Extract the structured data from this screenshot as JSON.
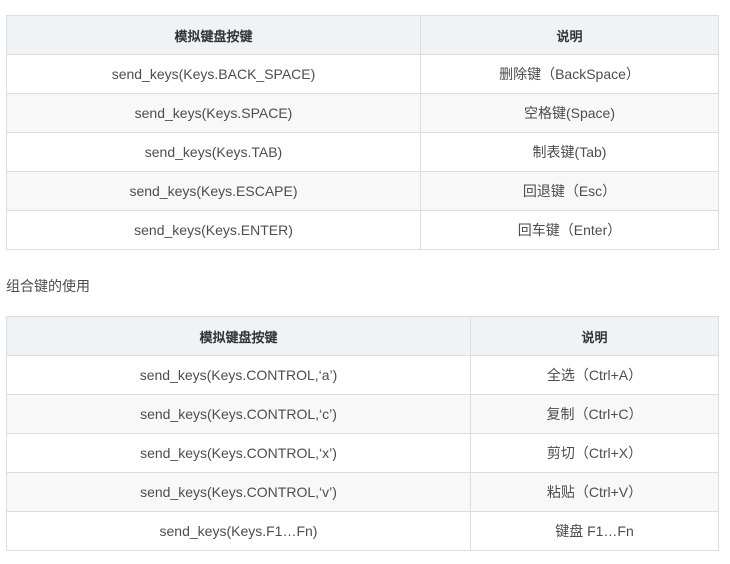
{
  "table1": {
    "headers": [
      "模拟键盘按键",
      "说明"
    ],
    "rows": [
      [
        "send_keys(Keys.BACK_SPACE)",
        "删除键（BackSpace）"
      ],
      [
        "send_keys(Keys.SPACE)",
        "空格键(Space)"
      ],
      [
        "send_keys(Keys.TAB)",
        "制表键(Tab)"
      ],
      [
        "send_keys(Keys.ESCAPE)",
        "回退键（Esc）"
      ],
      [
        "send_keys(Keys.ENTER)",
        "回车键（Enter）"
      ]
    ]
  },
  "section_label": "组合键的使用",
  "table2": {
    "headers": [
      "模拟键盘按键",
      "说明"
    ],
    "rows": [
      [
        "send_keys(Keys.CONTROL,‘a’)",
        "全选（Ctrl+A）"
      ],
      [
        "send_keys(Keys.CONTROL,‘c’)",
        "复制（Ctrl+C）"
      ],
      [
        "send_keys(Keys.CONTROL,‘x’)",
        "剪切（Ctrl+X）"
      ],
      [
        "send_keys(Keys.CONTROL,‘v’)",
        "粘贴（Ctrl+V）"
      ],
      [
        "send_keys(Keys.F1…Fn)",
        "键盘 F1…Fn"
      ]
    ]
  }
}
